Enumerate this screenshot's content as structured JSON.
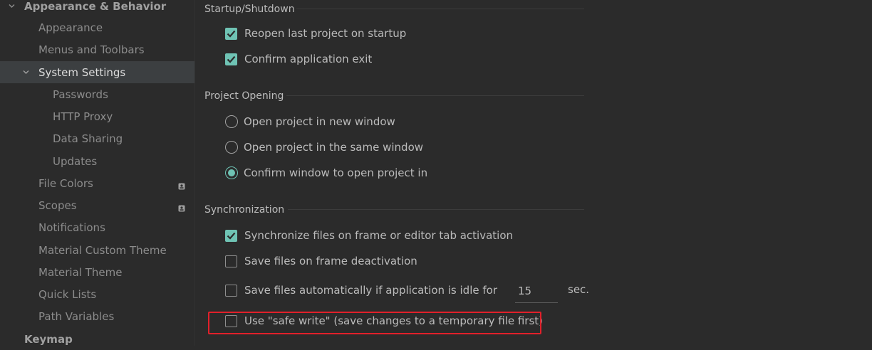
{
  "sidebar": {
    "section_appearance": "Appearance & Behavior",
    "items": [
      {
        "label": "Appearance"
      },
      {
        "label": "Menus and Toolbars"
      },
      {
        "label": "System Settings"
      },
      {
        "label": "Passwords"
      },
      {
        "label": "HTTP Proxy"
      },
      {
        "label": "Data Sharing"
      },
      {
        "label": "Updates"
      },
      {
        "label": "File Colors"
      },
      {
        "label": "Scopes"
      },
      {
        "label": "Notifications"
      },
      {
        "label": "Material Custom Theme"
      },
      {
        "label": "Material Theme"
      },
      {
        "label": "Quick Lists"
      },
      {
        "label": "Path Variables"
      }
    ],
    "section_keymap": "Keymap"
  },
  "startup": {
    "title": "Startup/Shutdown",
    "reopen_label": "Reopen last project on startup",
    "reopen_checked": true,
    "confirm_exit_label": "Confirm application exit",
    "confirm_exit_checked": true
  },
  "project_opening": {
    "title": "Project Opening",
    "options": [
      {
        "label": "Open project in new window",
        "selected": false
      },
      {
        "label": "Open project in the same window",
        "selected": false
      },
      {
        "label": "Confirm window to open project in",
        "selected": true
      }
    ]
  },
  "sync": {
    "title": "Synchronization",
    "sync_files_label": "Synchronize files on frame or editor tab activation",
    "sync_files_checked": true,
    "save_deactivation_label": "Save files on frame deactivation",
    "save_deactivation_checked": false,
    "save_idle_label": "Save files automatically if application is idle for",
    "save_idle_checked": false,
    "idle_seconds": "15",
    "idle_unit": "sec.",
    "safe_write_label": "Use \"safe write\" (save changes to a temporary file first)",
    "safe_write_checked": false
  },
  "colors": {
    "accent": "#6fc3b4",
    "highlight": "#e2202a",
    "background": "#2b2b2b",
    "selected_row": "#3c3f41"
  }
}
